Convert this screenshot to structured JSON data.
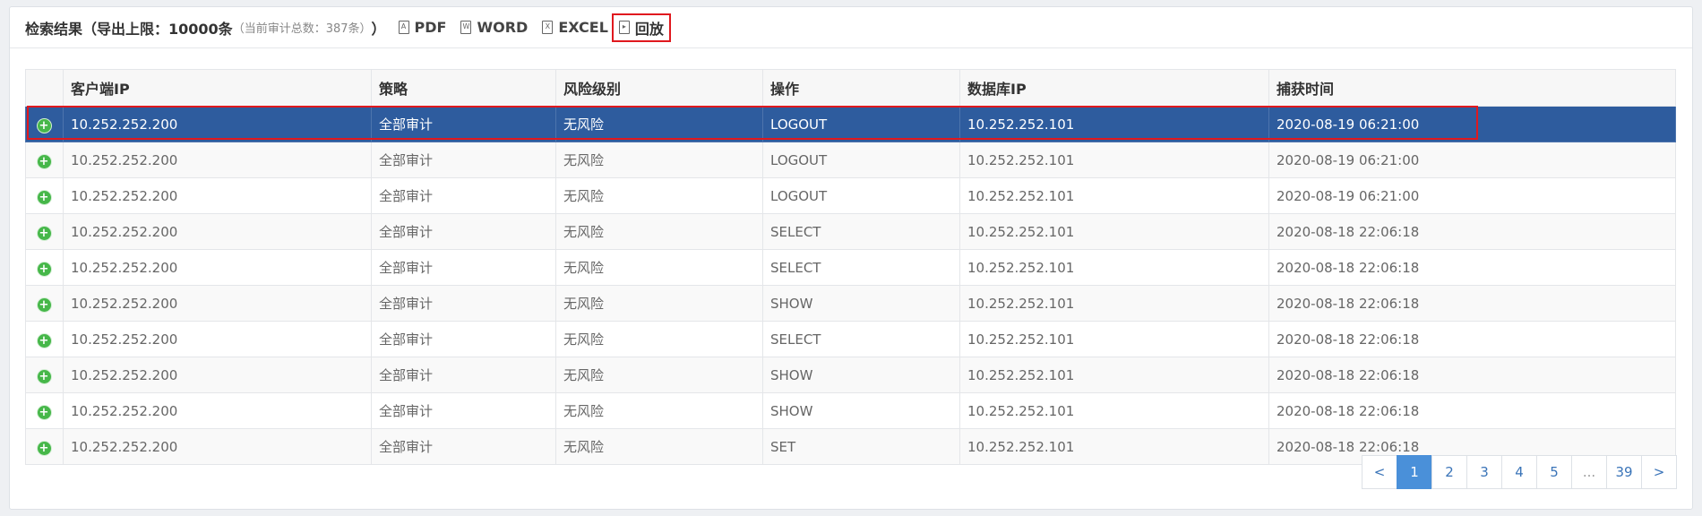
{
  "toolbar": {
    "title": "检索结果（导出上限：",
    "limit": "10000条",
    "sub": "（当前审计总数：387条）",
    "close_paren": "）",
    "exports": [
      {
        "label": "PDF",
        "icon": "pdf-file-icon",
        "glyph": "A"
      },
      {
        "label": "WORD",
        "icon": "word-file-icon",
        "glyph": "W"
      },
      {
        "label": "EXCEL",
        "icon": "excel-file-icon",
        "glyph": "X"
      }
    ],
    "replay_label": "回放",
    "replay_icon": "replay-file-icon"
  },
  "table": {
    "headers": [
      "客户端IP",
      "策略",
      "风险级别",
      "操作",
      "数据库IP",
      "捕获时间"
    ],
    "rows": [
      [
        "10.252.252.200",
        "全部审计",
        "无风险",
        "LOGOUT",
        "10.252.252.101",
        "2020-08-19 06:21:00"
      ],
      [
        "10.252.252.200",
        "全部审计",
        "无风险",
        "LOGOUT",
        "10.252.252.101",
        "2020-08-19 06:21:00"
      ],
      [
        "10.252.252.200",
        "全部审计",
        "无风险",
        "LOGOUT",
        "10.252.252.101",
        "2020-08-19 06:21:00"
      ],
      [
        "10.252.252.200",
        "全部审计",
        "无风险",
        "SELECT",
        "10.252.252.101",
        "2020-08-18 22:06:18"
      ],
      [
        "10.252.252.200",
        "全部审计",
        "无风险",
        "SELECT",
        "10.252.252.101",
        "2020-08-18 22:06:18"
      ],
      [
        "10.252.252.200",
        "全部审计",
        "无风险",
        "SHOW",
        "10.252.252.101",
        "2020-08-18 22:06:18"
      ],
      [
        "10.252.252.200",
        "全部审计",
        "无风险",
        "SELECT",
        "10.252.252.101",
        "2020-08-18 22:06:18"
      ],
      [
        "10.252.252.200",
        "全部审计",
        "无风险",
        "SHOW",
        "10.252.252.101",
        "2020-08-18 22:06:18"
      ],
      [
        "10.252.252.200",
        "全部审计",
        "无风险",
        "SHOW",
        "10.252.252.101",
        "2020-08-18 22:06:18"
      ],
      [
        "10.252.252.200",
        "全部审计",
        "无风险",
        "SET",
        "10.252.252.101",
        "2020-08-18 22:06:18"
      ]
    ],
    "selected_row": 0,
    "expand_icon": "expand-plus-icon"
  },
  "pagination": {
    "prev": "<",
    "pages": [
      "1",
      "2",
      "3",
      "4",
      "5",
      "...",
      "39"
    ],
    "active": "1",
    "next": ">"
  },
  "colors": {
    "selected_row": "#2e5c9e",
    "highlight_border": "#e0191e",
    "expand_icon": "#46b749",
    "active_page": "#4a90d9"
  }
}
